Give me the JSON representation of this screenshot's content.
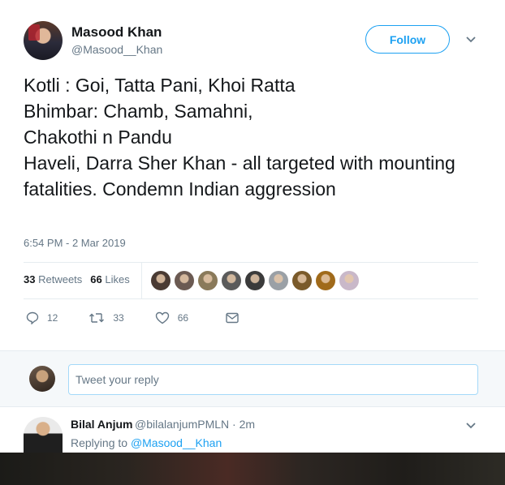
{
  "tweet": {
    "author_name": "Masood Khan",
    "author_handle": "@Masood__Khan",
    "follow_label": "Follow",
    "text": "Kotli : Goi, Tatta Pani, Khoi  Ratta\nBhimbar: Chamb, Samahni,\nChakothi n Pandu\nHaveli, Darra Sher Khan  - all targeted with mounting fatalities. Condemn Indian aggression",
    "timestamp": "6:54 PM - 2 Mar 2019",
    "retweets_count": "33",
    "retweets_label": "Retweets",
    "likes_count": "66",
    "likes_label": "Likes",
    "liker_faces": [
      "#4a3b33",
      "#6b5a52",
      "#8a7a5a",
      "#5b5b5b",
      "#3b3b3b",
      "#9aa0a6",
      "#7a5a2a",
      "#a06a1a",
      "#c9b8c9"
    ],
    "actions": {
      "reply_count": "12",
      "retweet_count": "33",
      "like_count": "66"
    }
  },
  "reply_box": {
    "placeholder": "Tweet your reply"
  },
  "reply": {
    "name": "Bilal Anjum",
    "meta": "@bilalanjumPMLN · 2m",
    "replying_prefix": "Replying to ",
    "replying_handle": "@Masood__Khan"
  },
  "colors": {
    "accent": "#1da1f2",
    "muted": "#657786",
    "text": "#14171a"
  }
}
